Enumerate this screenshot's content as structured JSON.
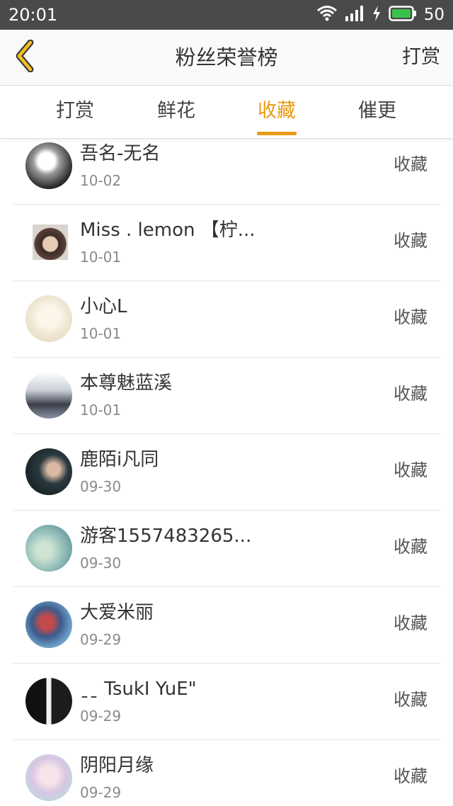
{
  "status_bar": {
    "time": "20:01",
    "battery": "50",
    "icons": [
      "wifi-icon",
      "signal-icon",
      "charging-icon",
      "battery-icon"
    ]
  },
  "nav": {
    "back_icon": "chevron-left-icon",
    "title": "粉丝荣誉榜",
    "action": "打赏"
  },
  "tabs": [
    {
      "label": "打赏",
      "active": false
    },
    {
      "label": "鲜花",
      "active": false
    },
    {
      "label": "收藏",
      "active": true
    },
    {
      "label": "催更",
      "active": false
    }
  ],
  "list": {
    "items": [
      {
        "name": "吾名-无名",
        "date": "10-02",
        "action": "收藏"
      },
      {
        "name": "Miss . lemon 【柠...",
        "date": "10-01",
        "action": "收藏"
      },
      {
        "name": "小心L",
        "date": "10-01",
        "action": "收藏"
      },
      {
        "name": "本尊魅蓝溪",
        "date": "10-01",
        "action": "收藏"
      },
      {
        "name": "鹿陌i凡同",
        "date": "09-30",
        "action": "收藏"
      },
      {
        "name": "游客1557483265...",
        "date": "09-30",
        "action": "收藏"
      },
      {
        "name": "大爱米丽",
        "date": "09-29",
        "action": "收藏"
      },
      {
        "name": "ˍˍ TsukI YuE\"",
        "date": "09-29",
        "action": "收藏"
      },
      {
        "name": "阴阳月缘",
        "date": "09-29",
        "action": "收藏"
      }
    ]
  },
  "colors": {
    "accent": "#e89a14",
    "status_bar": "#4a4a4a",
    "text": "#333333",
    "subtext": "#8a8a8a",
    "divider": "#e6e6e6"
  }
}
